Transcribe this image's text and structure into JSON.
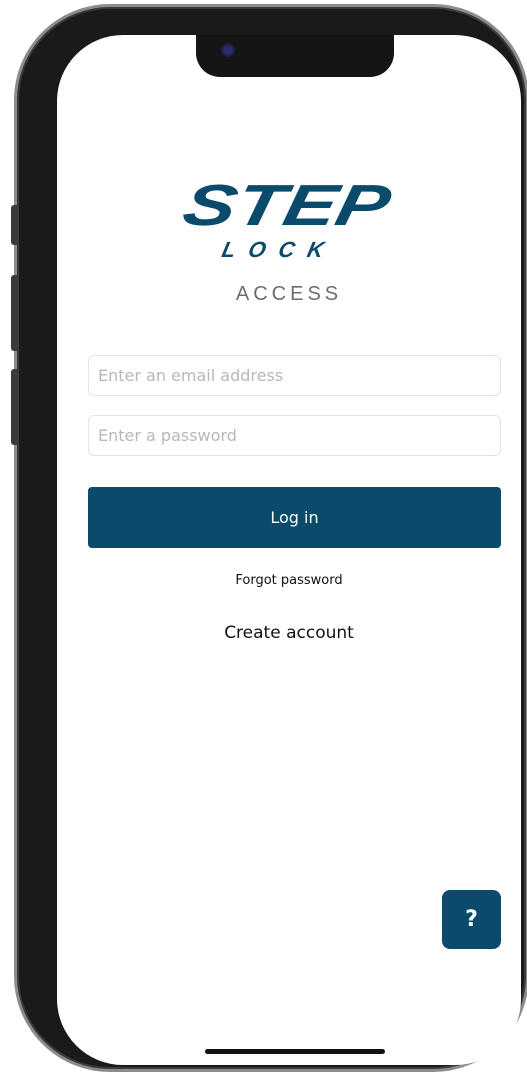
{
  "brand": {
    "logo_text": "STEP",
    "logo_subtext": "LOCK",
    "product_name": "ACCESS",
    "color": "#0a4a6b"
  },
  "login_form": {
    "email_placeholder": "Enter an email address",
    "email_value": "",
    "password_placeholder": "Enter a password",
    "password_value": "",
    "login_label": "Log in",
    "forgot_label": "Forgot password",
    "create_label": "Create account"
  },
  "help_button": {
    "label": "?",
    "icon": "question-mark-icon"
  }
}
